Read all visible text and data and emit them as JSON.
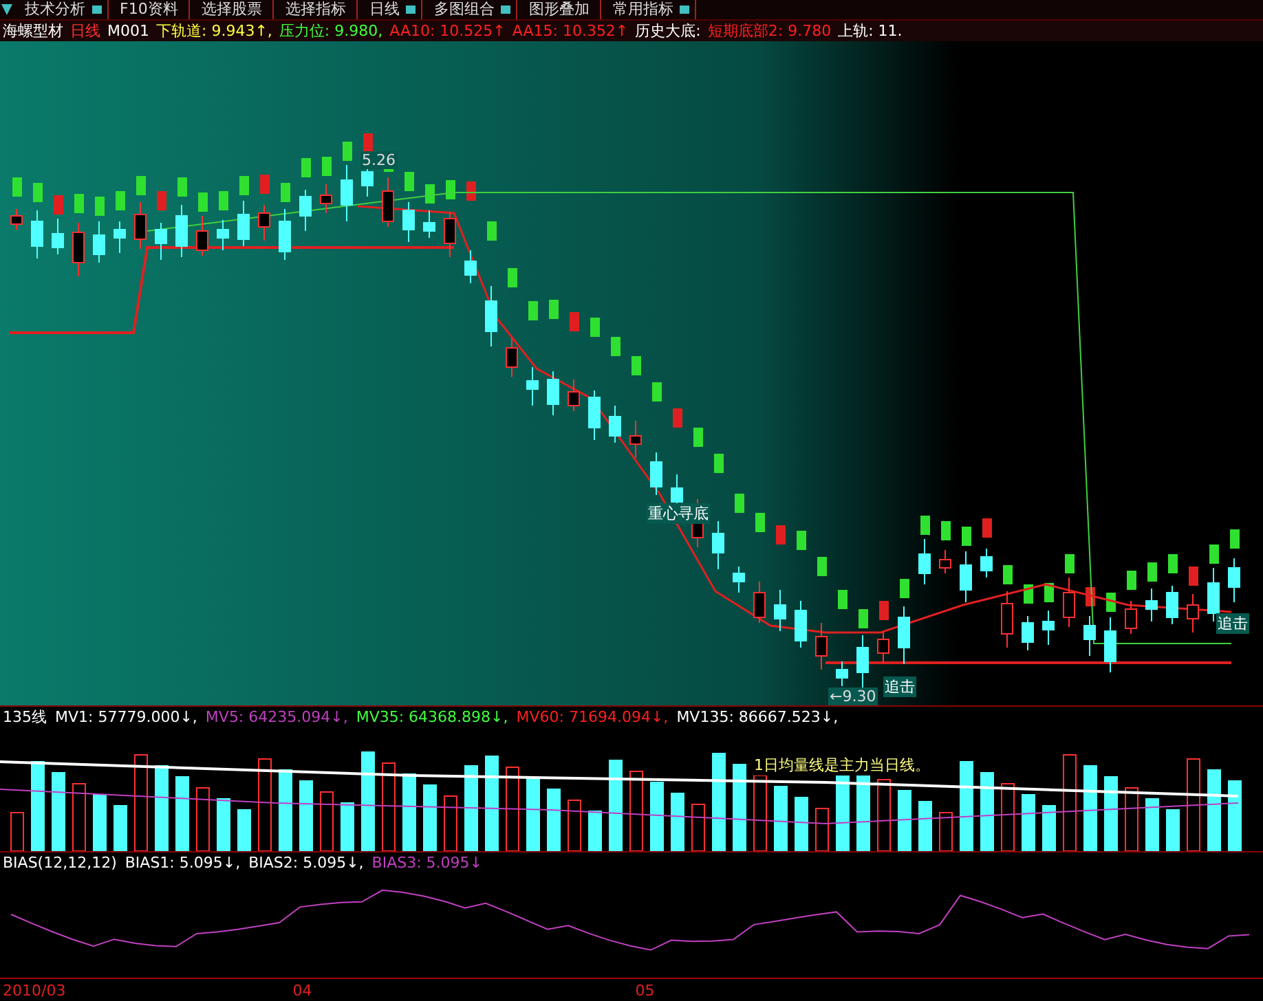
{
  "toolbar": [
    {
      "label": "技术分析",
      "dropdown": true
    },
    {
      "label": "F10资料",
      "dropdown": false
    },
    {
      "label": "选择股票",
      "dropdown": false
    },
    {
      "label": "选择指标",
      "dropdown": false
    },
    {
      "label": "日线",
      "dropdown": true
    },
    {
      "label": "多图组合",
      "dropdown": true
    },
    {
      "label": "图形叠加",
      "dropdown": false
    },
    {
      "label": "常用指标",
      "dropdown": true
    }
  ],
  "info_row": [
    {
      "text": "海螺型材",
      "color": "#ffffff"
    },
    {
      "text": "日线",
      "color": "#ff3030"
    },
    {
      "text": "M001",
      "color": "#ffffff"
    },
    {
      "text": "下轨道: 9.943↑,",
      "color": "#ffff40"
    },
    {
      "text": "压力位: 9.980,",
      "color": "#40ff40"
    },
    {
      "text": "AA10: 10.525↑",
      "color": "#ff2020"
    },
    {
      "text": "AA15: 10.352↑",
      "color": "#ff2020"
    },
    {
      "text": "历史大底:",
      "color": "#ffffff"
    },
    {
      "text": "短期底部2: 9.780",
      "color": "#ff2020"
    },
    {
      "text": "上轨: 11.",
      "color": "#ffffff"
    }
  ],
  "main_chart": {
    "labels": [
      {
        "text": "5.26",
        "kind": "price"
      },
      {
        "text": "重心寻底",
        "kind": "signal"
      },
      {
        "text": "追击",
        "kind": "signal"
      },
      {
        "text": "←9.30",
        "kind": "price"
      },
      {
        "text": "追击",
        "kind": "signal"
      }
    ]
  },
  "volume_panel": {
    "legend": [
      {
        "text": "135线",
        "color": "#ffffff"
      },
      {
        "text": "MV1: 57779.000↓,",
        "color": "#ffffff"
      },
      {
        "text": "MV5: 64235.094↓,",
        "color": "#c040c0"
      },
      {
        "text": "MV35: 64368.898↓,",
        "color": "#40ff40"
      },
      {
        "text": "MV60: 71694.094↓,",
        "color": "#ff2020"
      },
      {
        "text": "MV135: 86667.523↓,",
        "color": "#ffffff"
      }
    ],
    "note": "1日均量线是主力当日线。"
  },
  "bias_panel": {
    "legend": [
      {
        "text": "BIAS(12,12,12)",
        "color": "#ffffff"
      },
      {
        "text": "BIAS1: 5.095↓,",
        "color": "#ffffff"
      },
      {
        "text": "BIAS2: 5.095↓,",
        "color": "#ffffff"
      },
      {
        "text": "BIAS3: 5.095↓",
        "color": "#c040c0"
      }
    ]
  },
  "date_axis": [
    "2010/03",
    "04",
    "05"
  ]
}
